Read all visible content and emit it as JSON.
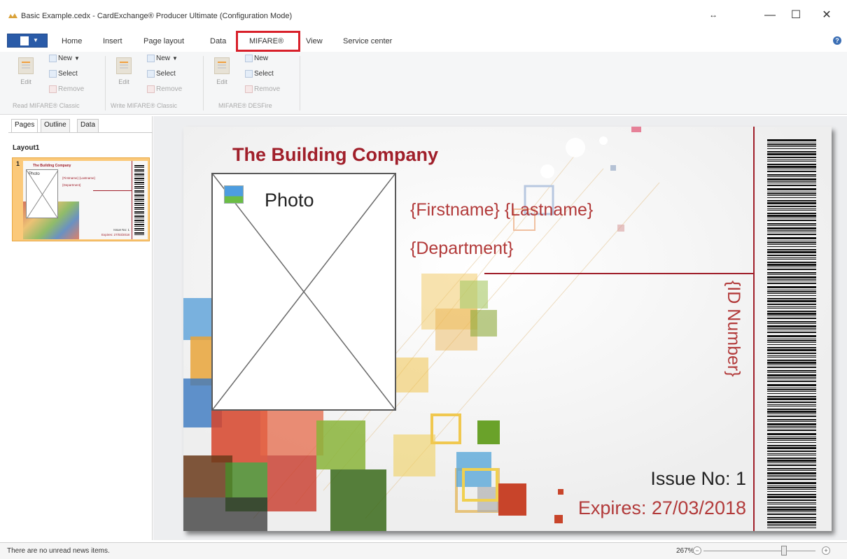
{
  "window": {
    "title": "Basic Example.cedx - CardExchange® Producer Ultimate (Configuration Mode)",
    "qat_icon": "double-arrow-icon",
    "minimize_glyph": "—",
    "maximize_glyph": "☐",
    "close_glyph": "✕"
  },
  "ribbon_tabs": {
    "items": [
      "Home",
      "Insert",
      "Page layout",
      "Data"
    ],
    "active": "MIFARE®",
    "after": [
      "View",
      "Service center"
    ],
    "help_glyph": "?"
  },
  "ribbon": {
    "groups": [
      {
        "label": "Read MIFARE® Classic",
        "edit_label": "Edit",
        "new_label": "New",
        "select_label": "Select",
        "remove_label": "Remove"
      },
      {
        "label": "Write MIFARE® Classic",
        "edit_label": "Edit",
        "new_label": "New",
        "select_label": "Select",
        "remove_label": "Remove"
      },
      {
        "label": "MIFARE® DESFire",
        "edit_label": "Edit",
        "new_label": "New",
        "select_label": "Select",
        "remove_label": "Remove"
      }
    ]
  },
  "left_panel": {
    "tabs": [
      "Pages",
      "Outline",
      "Data"
    ],
    "active_tab": "Pages",
    "layout_name": "Layout1",
    "page_number": "1",
    "thumb": {
      "title": "The Building Company",
      "photo": "Photo",
      "name": "{Firstname} {Lastname}",
      "dept": "{Department}",
      "issue": "Issue No: 1",
      "expires": "Expires: 27/03/2018"
    }
  },
  "card": {
    "company": "The Building Company",
    "photo_label": "Photo",
    "name_field": "{Firstname} {Lastname}",
    "department_field": "{Department}",
    "id_field": "{ID Number}",
    "issue": "Issue No: 1",
    "expires": "Expires: 27/03/2018",
    "colors": {
      "accent": "#a01f2a",
      "field_text": "#b23a3a"
    }
  },
  "statusbar": {
    "message": "There are no unread news items.",
    "zoom": "267%",
    "zoom_level": 0.72
  }
}
